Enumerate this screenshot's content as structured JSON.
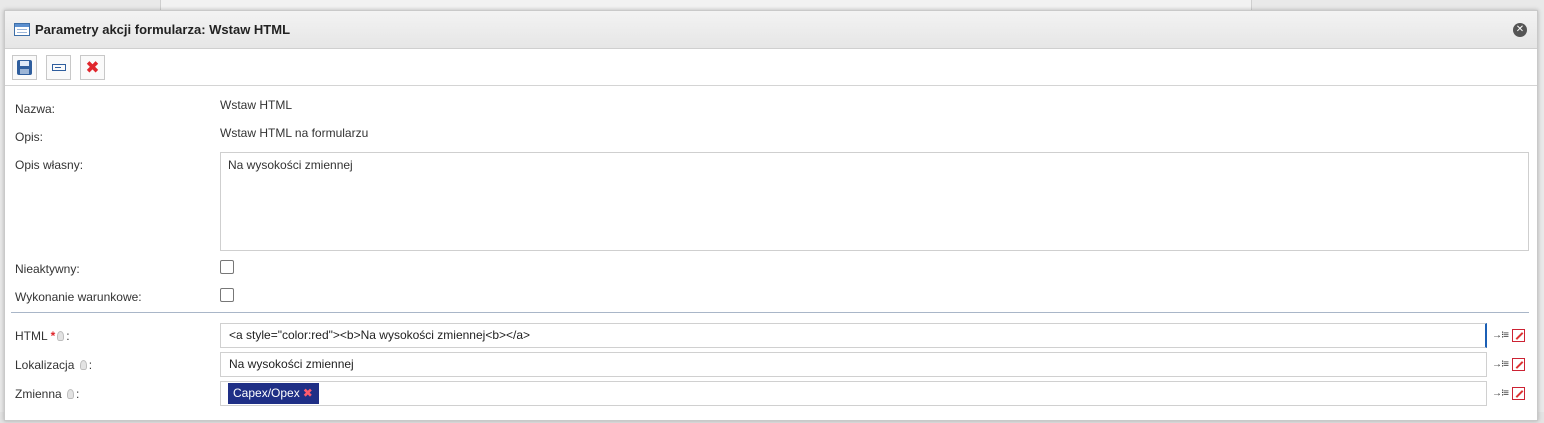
{
  "dialog": {
    "title": "Parametry akcji formularza: Wstaw HTML"
  },
  "toolbar": {
    "save_icon": "save-icon",
    "field_icon": "field-icon",
    "delete_icon": "close-x-icon"
  },
  "form": {
    "nazwa_label": "Nazwa:",
    "nazwa_value": "Wstaw HTML",
    "opis_label": "Opis:",
    "opis_value": "Wstaw HTML na formularzu",
    "opis_wlasny_label": "Opis własny:",
    "opis_wlasny_value": "Na wysokości zmiennej",
    "nieaktywny_label": "Nieaktywny:",
    "nieaktywny_checked": false,
    "warunkowe_label": "Wykonanie warunkowe:",
    "warunkowe_checked": false,
    "html_label": "HTML",
    "html_required": "*",
    "html_value": "<a style=\"color:red\"><b>Na wysokości zmiennej<b></a>",
    "lokalizacja_label": "Lokalizacja",
    "lokalizacja_value": "Na wysokości zmiennej",
    "zmienna_label": "Zmienna",
    "zmienna_tag": "Capex/Opex",
    "colon": ":"
  },
  "colors": {
    "tag_bg": "#1f2f86",
    "accent": "#1b5fb5",
    "required": "#e0262c"
  }
}
